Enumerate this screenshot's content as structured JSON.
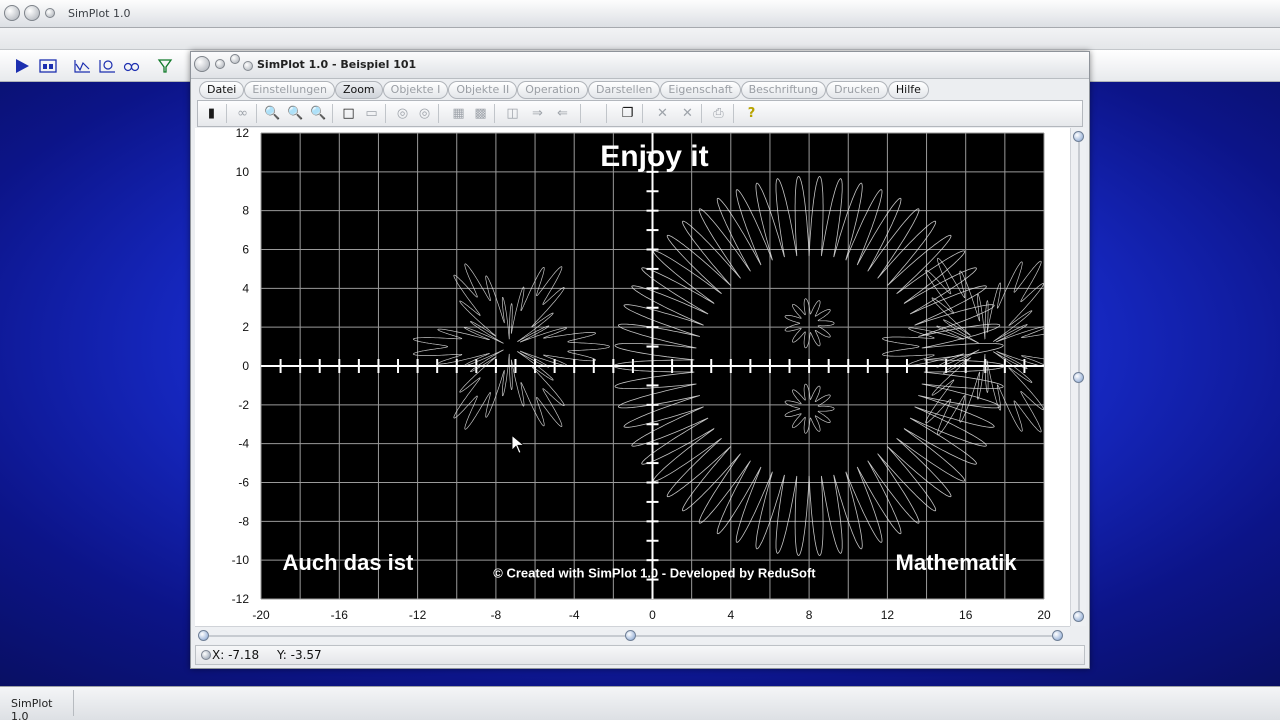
{
  "outer_window": {
    "title": "SimPlot 1.0",
    "toolbar_icons": [
      "play-icon",
      "screen-icon",
      "graph-icon",
      "graph-alt-icon",
      "loops-icon",
      "filter-icon"
    ]
  },
  "inner_window": {
    "title": "SimPlot 1.0 - Beispiel 101",
    "menu": [
      {
        "label": "Datei",
        "enabled": true
      },
      {
        "label": "Einstellungen",
        "enabled": false
      },
      {
        "label": "Zoom",
        "enabled": true
      },
      {
        "label": "Objekte I",
        "enabled": false
      },
      {
        "label": "Objekte II",
        "enabled": false
      },
      {
        "label": "Operation",
        "enabled": false
      },
      {
        "label": "Darstellen",
        "enabled": false
      },
      {
        "label": "Eigenschaft",
        "enabled": false
      },
      {
        "label": "Beschriftung",
        "enabled": false
      },
      {
        "label": "Drucken",
        "enabled": false
      },
      {
        "label": "Hilfe",
        "enabled": true
      }
    ],
    "toolbar_icons": [
      "calculator-icon",
      "glasses-icon",
      "zoom-out-icon",
      "zoom-neutral-icon",
      "zoom-in-icon",
      "square-icon",
      "split-icon",
      "circle-icon",
      "target-icon",
      "table-icon",
      "grid-icon",
      "shapes-icon",
      "arrow-right-icon",
      "arrow-left-icon",
      "copy-icon",
      "cross-icon",
      "cross-alt-icon",
      "print-icon",
      "help-icon"
    ],
    "status": {
      "x_label": "X:",
      "x_value": "-7.18",
      "y_label": "Y:",
      "y_value": "-3.57"
    }
  },
  "plot": {
    "annotations": {
      "top": "Enjoy it",
      "bottom_left": "Auch das ist",
      "bottom_right": "Mathematik",
      "credit": "© Created with SimPlot 1.0 - Developed by ReduSoft"
    },
    "colors": {
      "background": "#000000",
      "grid": "#9a9a9a",
      "curve": "#e8e8e8",
      "text": "#ffffff"
    }
  },
  "chart_data": {
    "type": "line",
    "title": "",
    "xlim": [
      -20,
      20
    ],
    "ylim": [
      -12,
      12
    ],
    "x_ticks": [
      -20,
      -16,
      -12,
      -8,
      -4,
      0,
      4,
      8,
      12,
      16,
      20
    ],
    "y_ticks": [
      12,
      10,
      8,
      6,
      4,
      2,
      0,
      -2,
      -4,
      -6,
      -8,
      -10,
      -12
    ],
    "grid": true,
    "series": [
      {
        "shape": "hexagonal rosette knot",
        "center": [
          -7.3,
          1.0
        ],
        "radius": 4.4
      },
      {
        "shape": "large spirograph ring",
        "center": [
          8.0,
          0.0
        ],
        "radius": 10.5
      },
      {
        "shape": "hexagonal rosette knot",
        "center": [
          17.0,
          1.0
        ],
        "radius": 4.7
      }
    ]
  }
}
